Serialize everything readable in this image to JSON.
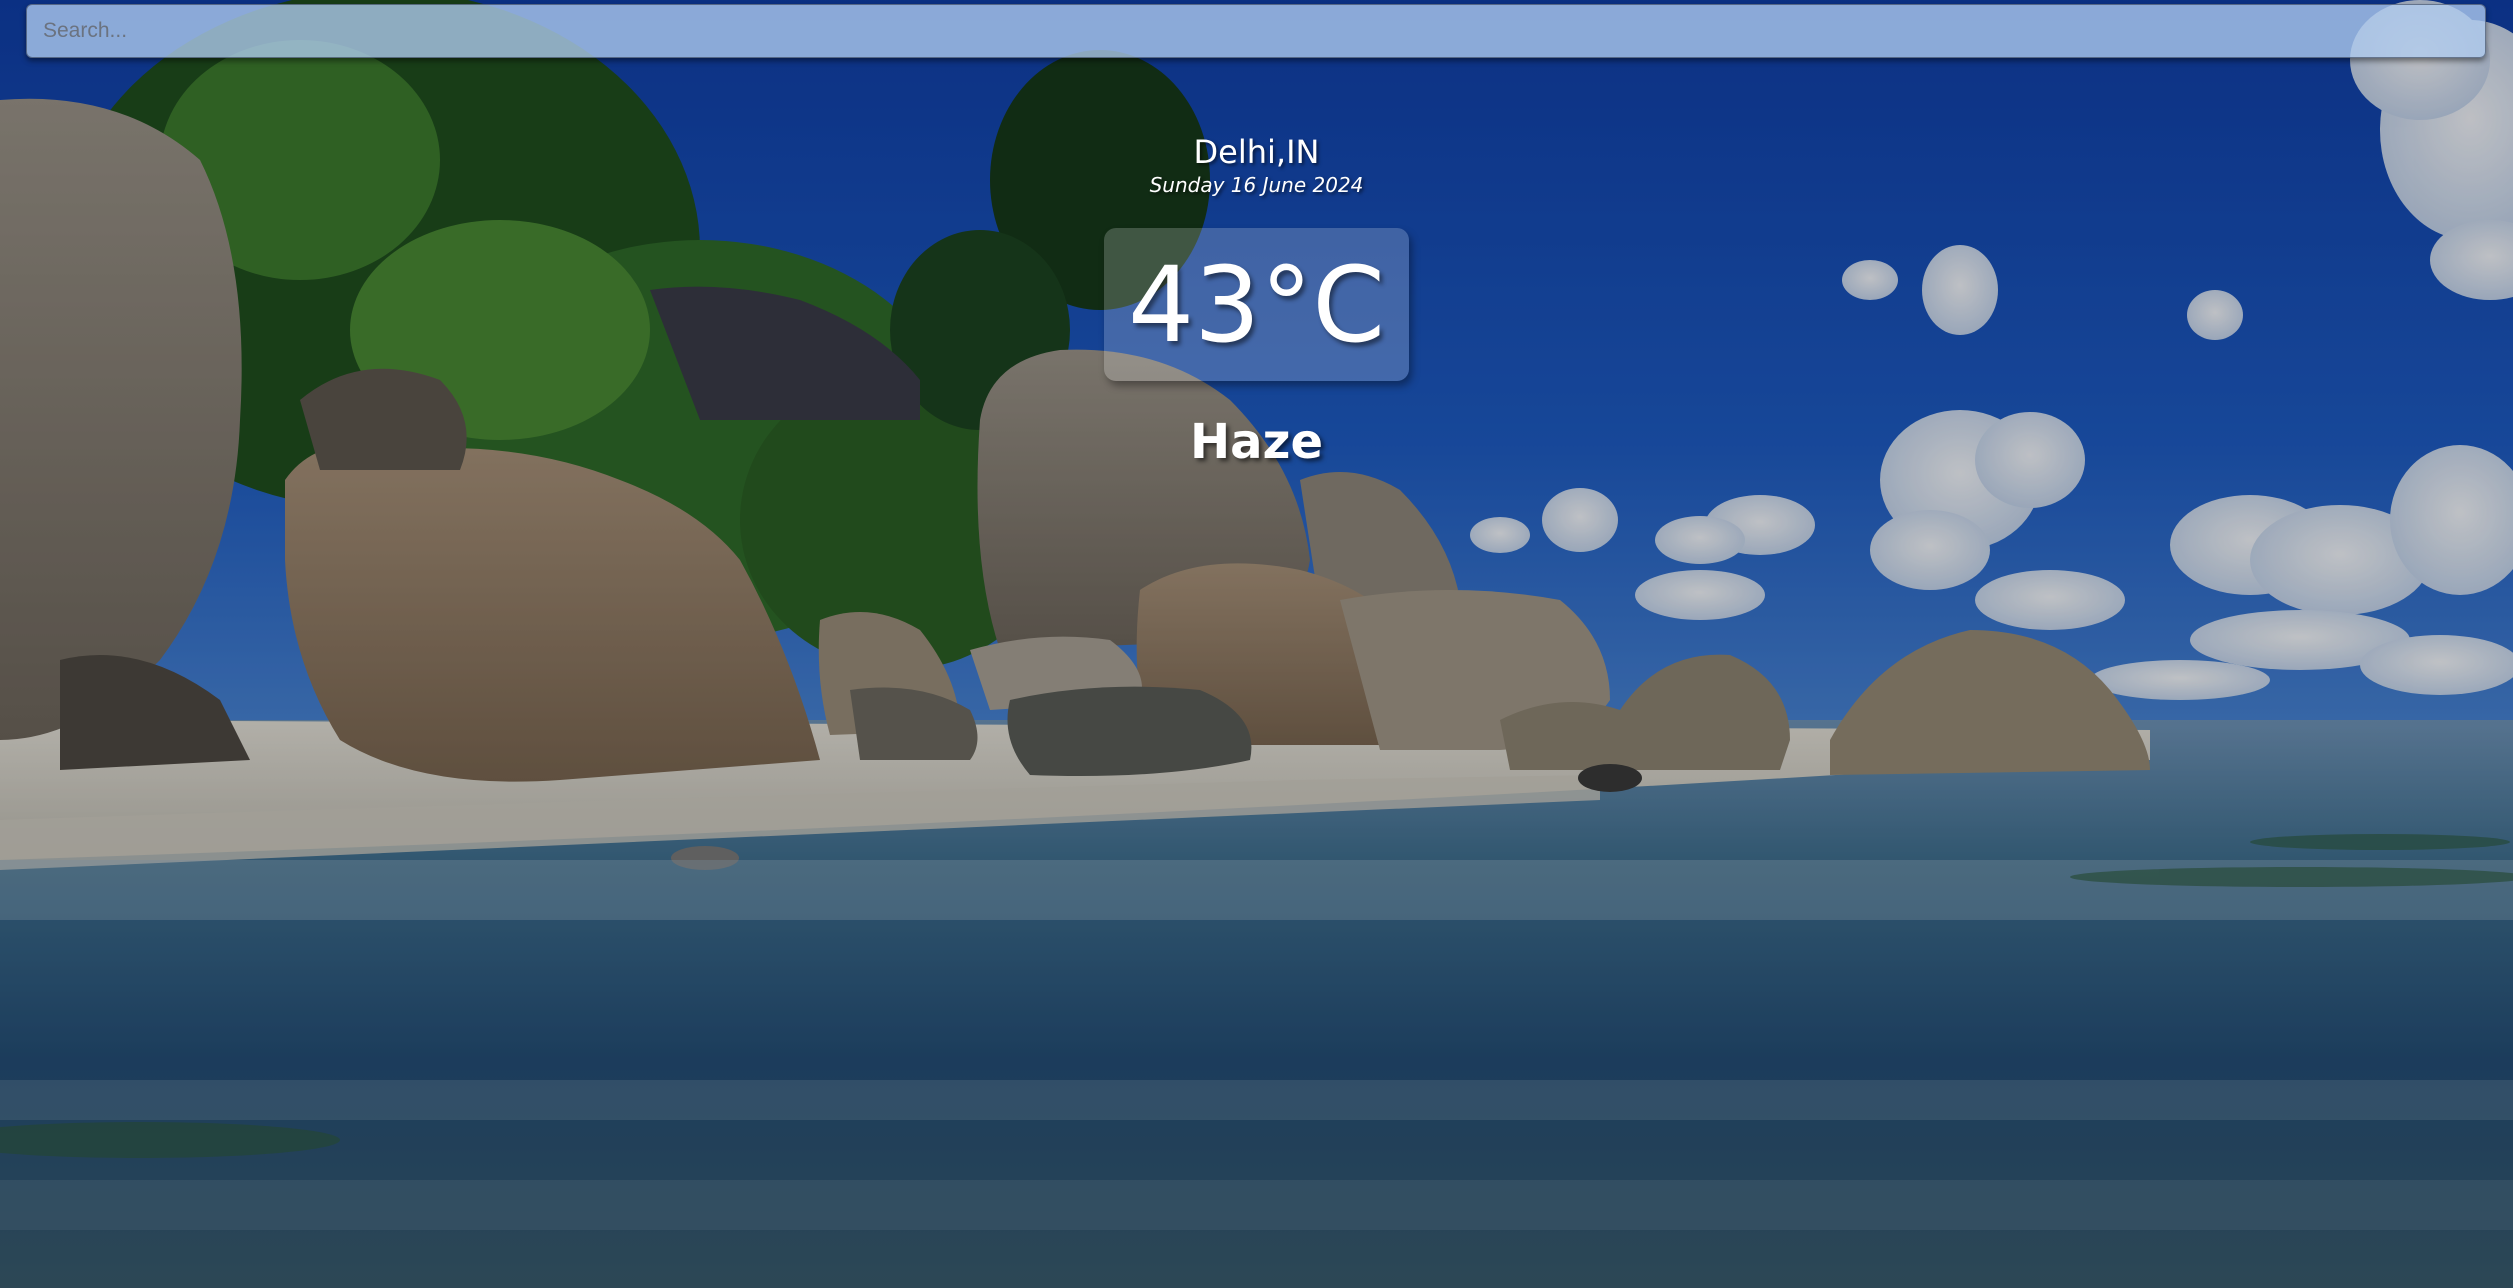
{
  "search": {
    "placeholder": "Search..."
  },
  "location": {
    "city": "Delhi,IN",
    "date": "Sunday 16 June 2024"
  },
  "weather": {
    "temperature": "43°C",
    "condition": "Haze"
  },
  "background": {
    "description_icon": "beach-landscape-image",
    "colors": {
      "sky": "#1e56b8",
      "water": "#2a5c8a",
      "sand": "#d9d7cf",
      "rock": "#8c8478",
      "foliage": "#2f6b2a"
    }
  }
}
